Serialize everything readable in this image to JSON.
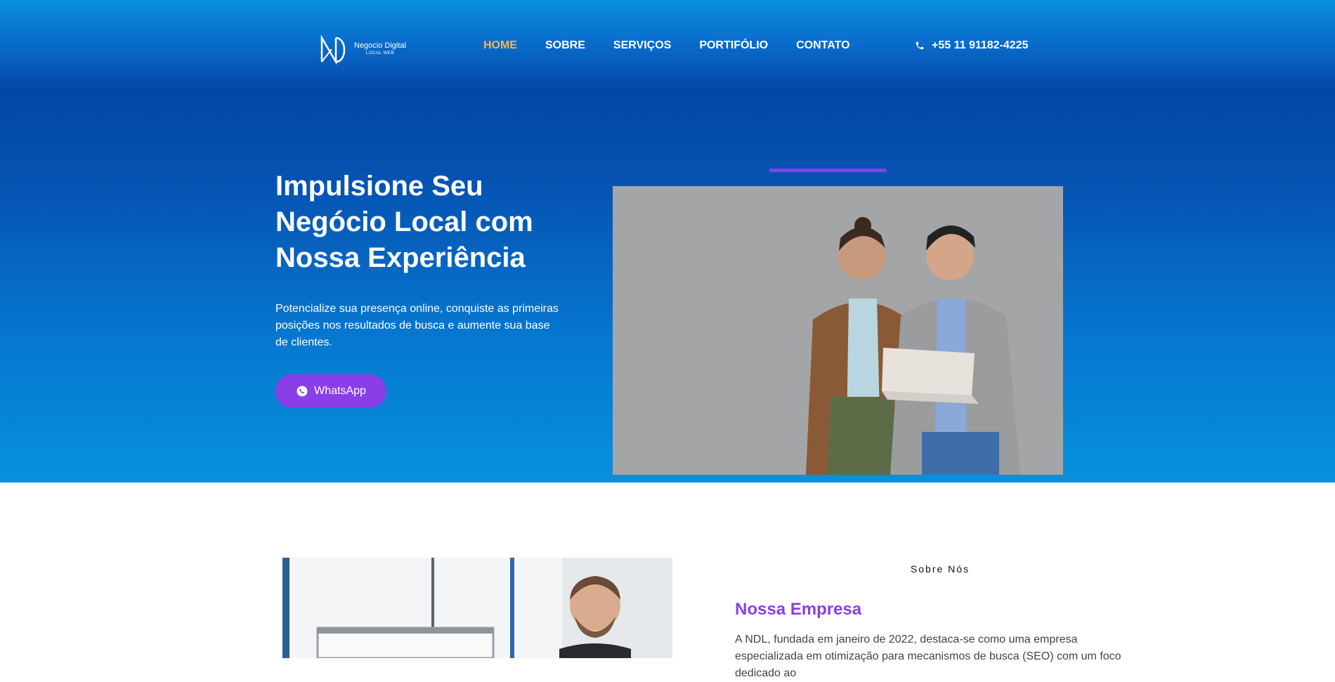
{
  "brand": {
    "name": "Negocio Digital",
    "tagline": "LOCAL WEB",
    "accent": "#8a3ee8",
    "nav_active_color": "#f2b55b"
  },
  "nav": {
    "items": [
      {
        "label": "HOME",
        "active": true
      },
      {
        "label": "SOBRE",
        "active": false
      },
      {
        "label": "SERVIÇOS",
        "active": false
      },
      {
        "label": "PORTIFÓLIO",
        "active": false
      },
      {
        "label": "CONTATO",
        "active": false
      }
    ],
    "phone": "+55 11 91182-4225",
    "phone_icon": "phone-icon"
  },
  "hero": {
    "title": "Impulsione Seu Negócio Local com Nossa Experiência",
    "subtitle": "Potencialize sua presença online, conquiste as primeiras posições nos resultados de busca e aumente sua base de clientes.",
    "cta_label": "WhatsApp",
    "cta_icon": "whatsapp-icon"
  },
  "about": {
    "label": "Sobre Nós",
    "title": "Nossa Empresa",
    "text": "A NDL, fundada em janeiro de 2022, destaca-se como uma empresa especializada em otimização para mecanismos de busca (SEO) com um foco dedicado ao"
  }
}
